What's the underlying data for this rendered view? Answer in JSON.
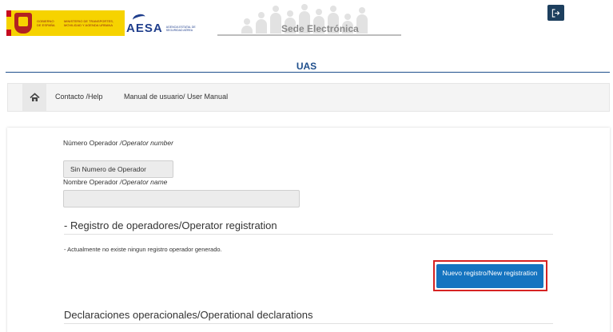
{
  "header": {
    "gov_text_1": "GOBIERNO DE ESPAÑA",
    "gov_text_2": "MINISTERIO DE TRANSPORTES, MOVILIDAD Y AGENDA URBANA",
    "aesa_mark": "AESA",
    "aesa_text": "AGENCIA ESTATAL DE SEGURIDAD AÉREA",
    "portal_title": "Sede Electrónica",
    "logout_icon": "logout-icon"
  },
  "page": {
    "title": "UAS"
  },
  "nav": {
    "home_icon": "home-icon",
    "links": [
      "Contacto /Help",
      "Manual de usuario/ User Manual"
    ]
  },
  "form": {
    "operator_number_label": "Número Operador ",
    "operator_number_label_en": "/Operator number",
    "operator_number_value": "Sin Numero de Operador",
    "operator_name_label": "Nombre Operador ",
    "operator_name_label_en": "/Operator name",
    "operator_name_value": ""
  },
  "registration": {
    "title": "- Registro de operadores/Operator registration",
    "empty_note": "- Actualmente no existe ningun registro operador generado.",
    "new_button": "Nuevo registro/New registration"
  },
  "declarations": {
    "title": "Declaraciones operacionales/Operational declarations"
  },
  "colors": {
    "accent": "#1574c0",
    "highlight": "#d62222",
    "title_blue": "#1e4e8c"
  }
}
